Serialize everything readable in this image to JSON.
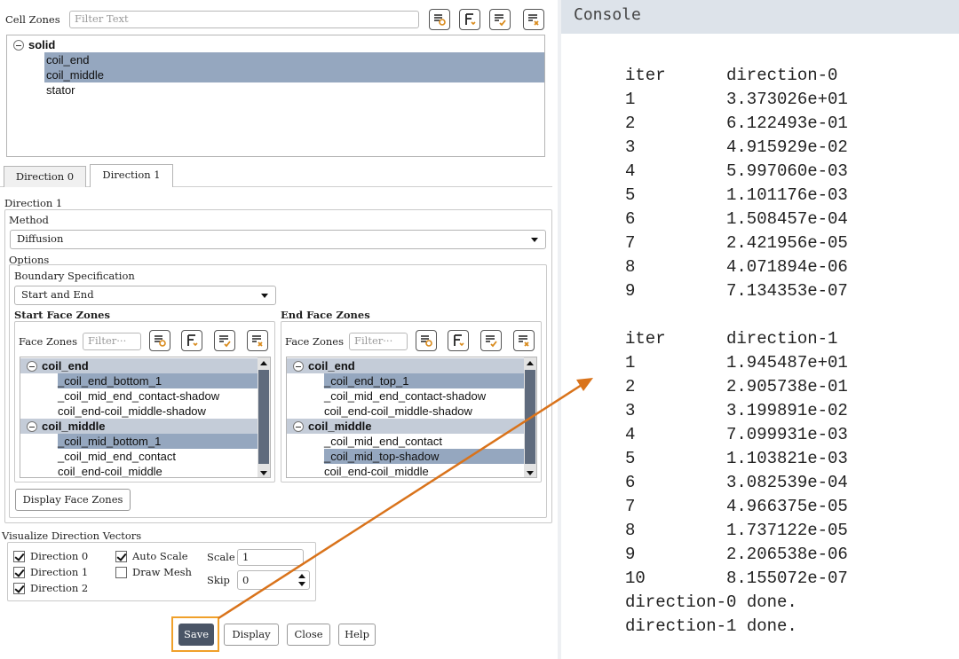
{
  "cell_zones": {
    "label": "Cell Zones",
    "filter_placeholder": "Filter Text",
    "tree": {
      "group": "solid",
      "items": [
        {
          "label": "coil_end",
          "selected": true
        },
        {
          "label": "coil_middle",
          "selected": true
        },
        {
          "label": "stator",
          "selected": false
        }
      ]
    }
  },
  "tabs": [
    {
      "label": "Direction 0",
      "active": false
    },
    {
      "label": "Direction 1",
      "active": true
    }
  ],
  "direction": {
    "title": "Direction 1",
    "method_label": "Method",
    "method_value": "Diffusion",
    "options_label": "Options",
    "boundary_label": "Boundary Specification",
    "boundary_value": "Start and End",
    "start": {
      "label": "Start Face Zones",
      "filter_label": "Face Zones",
      "filter_placeholder": "Filter···",
      "groups": [
        {
          "label": "coil_end",
          "items": [
            {
              "label": "_coil_end_bottom_1",
              "selected": true
            },
            {
              "label": "_coil_mid_end_contact-shadow",
              "selected": false
            },
            {
              "label": "coil_end-coil_middle-shadow",
              "selected": false
            }
          ]
        },
        {
          "label": "coil_middle",
          "items": [
            {
              "label": "_coil_mid_bottom_1",
              "selected": true
            },
            {
              "label": "_coil_mid_end_contact",
              "selected": false
            },
            {
              "label": "coil_end-coil_middle",
              "selected": false
            }
          ]
        }
      ]
    },
    "end": {
      "label": "End Face Zones",
      "filter_label": "Face Zones",
      "filter_placeholder": "Filter···",
      "groups": [
        {
          "label": "coil_end",
          "items": [
            {
              "label": "_coil_end_top_1",
              "selected": true
            },
            {
              "label": "_coil_mid_end_contact-shadow",
              "selected": false
            },
            {
              "label": "coil_end-coil_middle-shadow",
              "selected": false
            }
          ]
        },
        {
          "label": "coil_middle",
          "items": [
            {
              "label": "_coil_mid_end_contact",
              "selected": false
            },
            {
              "label": "_coil_mid_top-shadow",
              "selected": true
            },
            {
              "label": "coil_end-coil_middle",
              "selected": false
            }
          ]
        }
      ]
    },
    "display_face_zones": "Display Face Zones"
  },
  "visualize": {
    "label": "Visualize Direction Vectors",
    "dir0": {
      "label": "Direction 0",
      "checked": true
    },
    "dir1": {
      "label": "Direction 1",
      "checked": true
    },
    "dir2": {
      "label": "Direction 2",
      "checked": true
    },
    "auto_scale": {
      "label": "Auto Scale",
      "checked": true
    },
    "draw_mesh": {
      "label": "Draw Mesh",
      "checked": false
    },
    "scale_label": "Scale",
    "scale_value": "1",
    "skip_label": "Skip",
    "skip_value": "0"
  },
  "buttons": {
    "save": "Save",
    "display": "Display",
    "close": "Close",
    "help": "Help"
  },
  "console": {
    "title": "Console",
    "lines": [
      {
        "a": "iter",
        "b": "direction-0"
      },
      {
        "a": "1",
        "b": "3.373026e+01"
      },
      {
        "a": "2",
        "b": "6.122493e-01"
      },
      {
        "a": "3",
        "b": "4.915929e-02"
      },
      {
        "a": "4",
        "b": "5.997060e-03"
      },
      {
        "a": "5",
        "b": "1.101176e-03"
      },
      {
        "a": "6",
        "b": "1.508457e-04"
      },
      {
        "a": "7",
        "b": "2.421956e-05"
      },
      {
        "a": "8",
        "b": "4.071894e-06"
      },
      {
        "a": "9",
        "b": "7.134353e-07"
      },
      {
        "a": "",
        "b": ""
      },
      {
        "a": "iter",
        "b": "direction-1"
      },
      {
        "a": "1",
        "b": "1.945487e+01"
      },
      {
        "a": "2",
        "b": "2.905738e-01"
      },
      {
        "a": "3",
        "b": "3.199891e-02"
      },
      {
        "a": "4",
        "b": "7.099931e-03"
      },
      {
        "a": "5",
        "b": "1.103821e-03"
      },
      {
        "a": "6",
        "b": "3.082539e-04"
      },
      {
        "a": "7",
        "b": "4.966375e-05"
      },
      {
        "a": "8",
        "b": "1.737122e-05"
      },
      {
        "a": "9",
        "b": "2.206538e-06"
      },
      {
        "a": "10",
        "b": "8.155072e-07"
      },
      {
        "a": "direction-0 done.",
        "b": ""
      },
      {
        "a": "direction-1 done.",
        "b": ""
      }
    ]
  },
  "colors": {
    "selection": "#95a7bf",
    "highlight": "#c4ccd8",
    "annotation": "#d9731b",
    "console_header": "#dde3ea"
  }
}
